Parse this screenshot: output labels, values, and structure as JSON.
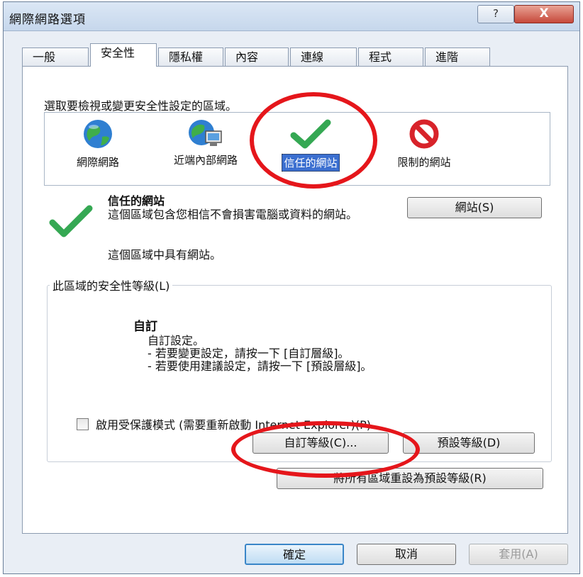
{
  "window": {
    "title": "網際網路選項",
    "help_label": "?",
    "close_label": "X"
  },
  "tabs": [
    {
      "label": "一般",
      "active": false
    },
    {
      "label": "安全性",
      "active": true
    },
    {
      "label": "隱私權",
      "active": false
    },
    {
      "label": "內容",
      "active": false
    },
    {
      "label": "連線",
      "active": false
    },
    {
      "label": "程式",
      "active": false
    },
    {
      "label": "進階",
      "active": false
    }
  ],
  "security": {
    "zone_prompt": "選取要檢視或變更安全性設定的區域。",
    "zones": [
      {
        "label": "網際網路",
        "icon": "globe-icon",
        "selected": false
      },
      {
        "label": "近端內部網路",
        "icon": "local-intranet-icon",
        "selected": false
      },
      {
        "label": "信任的網站",
        "icon": "check-mark-icon",
        "selected": true
      },
      {
        "label": "限制的網站",
        "icon": "prohibited-icon",
        "selected": false
      }
    ],
    "selected_zone": {
      "title": "信任的網站",
      "description": "這個區域包含您相信不會損害電腦或資料的網站。",
      "note": "這個區域中具有網站。"
    },
    "sites_button": "網站(S)",
    "level_group_label": "此區域的安全性等級(L)",
    "level_name": "自訂",
    "level_lines": [
      "自訂設定。",
      "- 若要變更設定，請按一下 [自訂層級]。",
      "- 若要使用建議設定，請按一下 [預設層級]。"
    ],
    "protected_mode_label": "啟用受保護模式 (需要重新啟動 Internet Explorer)(P)",
    "protected_mode_checked": false,
    "custom_level_button": "自訂等級(C)...",
    "default_level_button": "預設等級(D)",
    "reset_all_button": "將所有區域重設為預設等級(R)"
  },
  "footer": {
    "ok_label": "確定",
    "cancel_label": "取消",
    "apply_label": "套用(A)"
  },
  "colors": {
    "highlight_ring": "#e5161b",
    "selection": "#3b6fd0",
    "check_green": "#35a853"
  }
}
